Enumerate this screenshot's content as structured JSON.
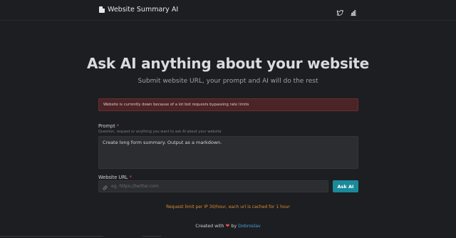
{
  "header": {
    "brand_title": "Website Summary AI",
    "icons": [
      "document-icon",
      "twitter-icon",
      "bar-chart-icon"
    ]
  },
  "hero": {
    "title": "Ask AI anything about your website",
    "subtitle": "Submit website URL, your prompt and AI will do the rest"
  },
  "alert": {
    "text": "Website is currently down because of a lot bot requests bypassing rate limits",
    "color": "#4a2426"
  },
  "prompt": {
    "label": "Prompt",
    "required_mark": "*",
    "hint": "Question, request or anything you want to ask AI about your website",
    "value": "Create long form summary. Output as a markdown."
  },
  "website_url": {
    "label": "Website URL",
    "required_mark": "*",
    "placeholder": "eg. https://twitter.com",
    "value": ""
  },
  "ask_button": {
    "label": "Ask AI",
    "color": "#1a8a9a"
  },
  "rate_limit": {
    "text": "Request limit per IP 30/hour, each url is cached for 1 hour",
    "color": "#d98c2f"
  },
  "footer": {
    "created_with": "Created with",
    "by": "by",
    "author": "Dobroslav"
  }
}
